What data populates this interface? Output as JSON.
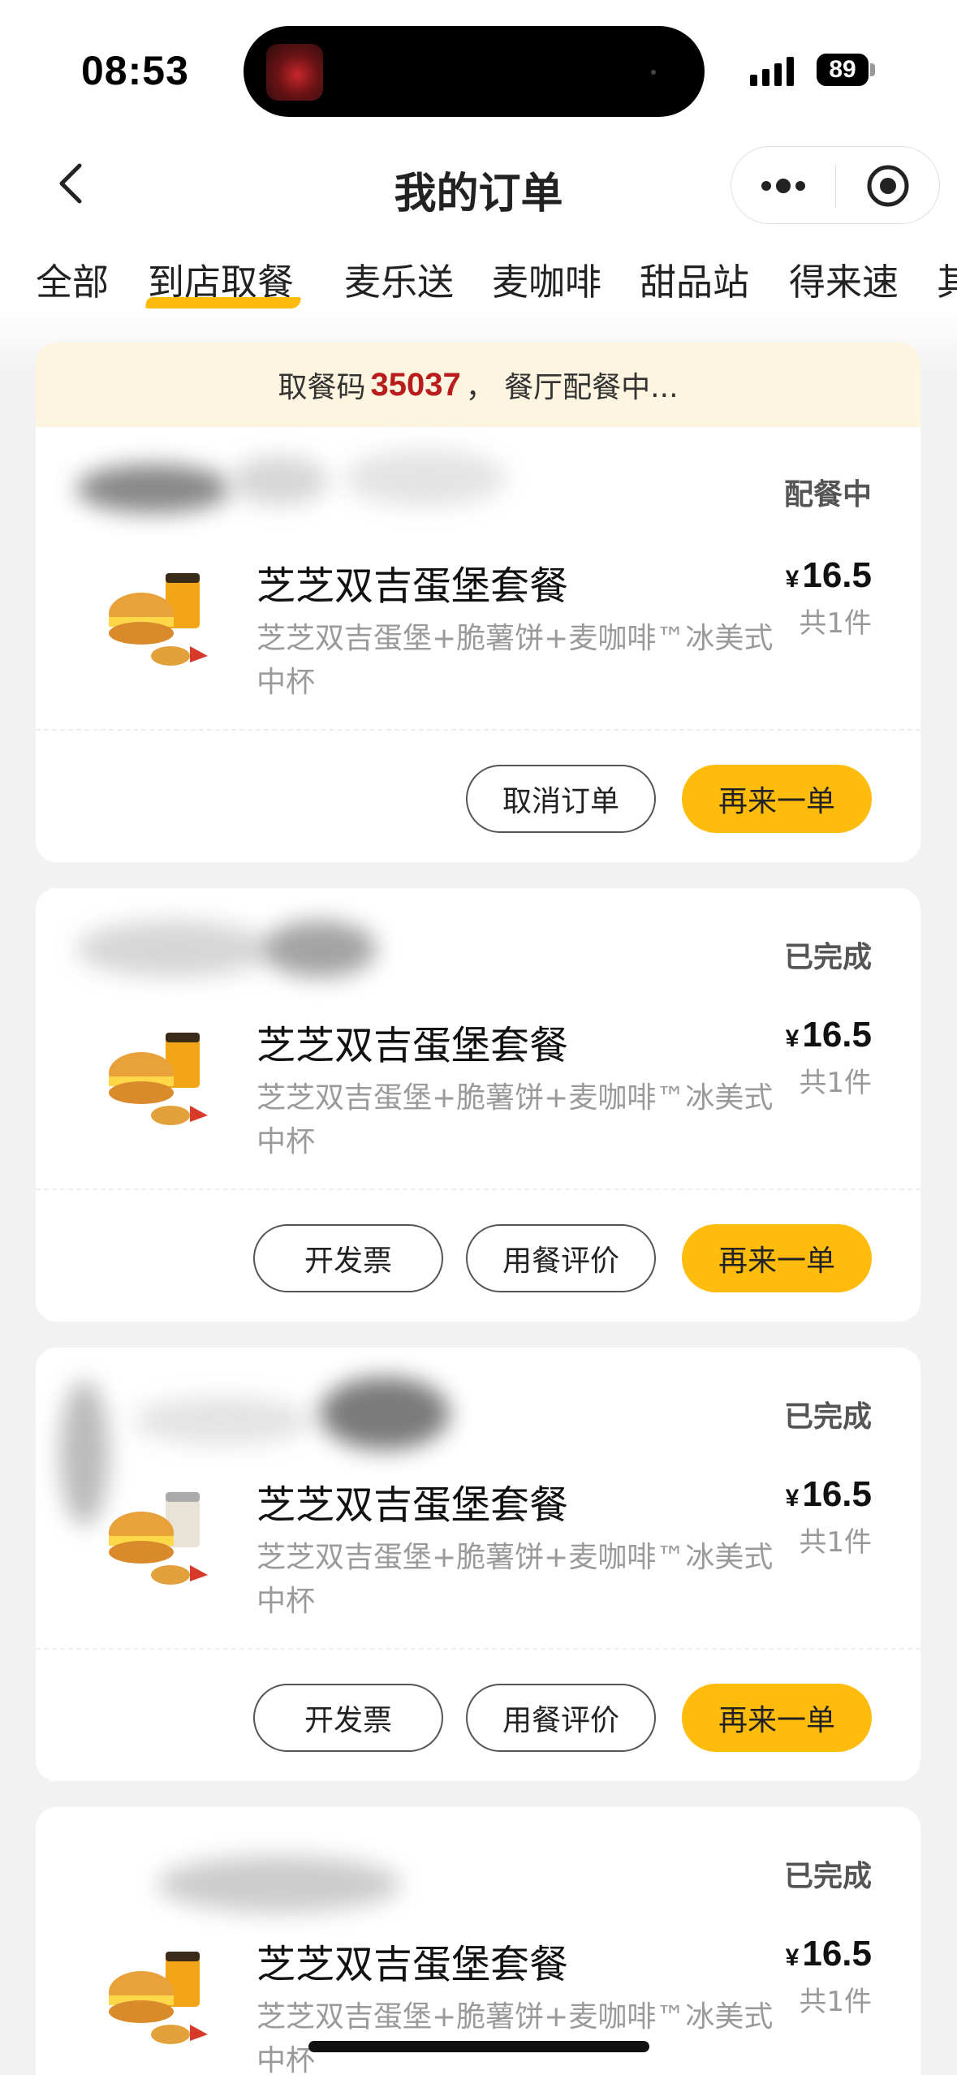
{
  "status_bar": {
    "time": "08:53",
    "battery": "89"
  },
  "nav": {
    "title": "我的订单"
  },
  "tabs": [
    "全部",
    "到店取餐",
    "麦乐送",
    "麦咖啡",
    "甜品站",
    "得来速",
    "其"
  ],
  "pickup": {
    "prefix": "取餐码",
    "code": "35037",
    "suffix": "，  餐厅配餐中..."
  },
  "orders": [
    {
      "status": "配餐中",
      "name": "芝芝双吉蛋堡套餐",
      "desc": "芝芝双吉蛋堡+脆薯饼+麦咖啡™冰美式中杯",
      "currency": "¥",
      "price": "16.5",
      "qty": "共1件",
      "buttons": [
        "取消订单",
        "再来一单"
      ]
    },
    {
      "status": "已完成",
      "name": "芝芝双吉蛋堡套餐",
      "desc": "芝芝双吉蛋堡+脆薯饼+麦咖啡™冰美式中杯",
      "currency": "¥",
      "price": "16.5",
      "qty": "共1件",
      "buttons": [
        "开发票",
        "用餐评价",
        "再来一单"
      ]
    },
    {
      "status": "已完成",
      "name": "芝芝双吉蛋堡套餐",
      "desc": "芝芝双吉蛋堡+脆薯饼+麦咖啡™冰美式中杯",
      "currency": "¥",
      "price": "16.5",
      "qty": "共1件",
      "buttons": [
        "开发票",
        "用餐评价",
        "再来一单"
      ]
    },
    {
      "status": "已完成",
      "name": "芝芝双吉蛋堡套餐",
      "desc": "芝芝双吉蛋堡+脆薯饼+麦咖啡™冰美式中杯",
      "currency": "¥",
      "price": "16.5",
      "qty": "共1件"
    }
  ],
  "icons": {
    "back": "chevron-left-icon",
    "more": "more-dots-icon",
    "close": "target-close-icon",
    "signal": "signal-bars-icon",
    "battery": "battery-icon",
    "meal": "meal-combo-icon"
  },
  "colors": {
    "accent": "#ffbc0d",
    "pickup_code": "#b81c1c",
    "banner_bg": "#fdf5df"
  }
}
